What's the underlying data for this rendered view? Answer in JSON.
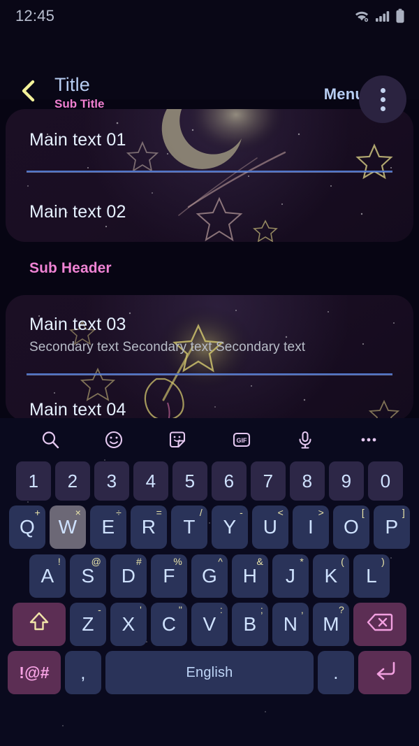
{
  "status_bar": {
    "time": "12:45",
    "icons": [
      "wifi-icon",
      "signal-icon",
      "battery-icon"
    ]
  },
  "app_bar": {
    "back_icon": "chevron-left-icon",
    "title": "Title",
    "subtitle": "Sub Title",
    "menu_label": "Menu",
    "overflow_icon": "more-vertical-icon"
  },
  "content": {
    "card1": {
      "rows": [
        {
          "main": "Main text 01"
        },
        {
          "main": "Main text 02"
        }
      ]
    },
    "sub_header": "Sub Header",
    "card2": {
      "rows": [
        {
          "main": "Main text 03",
          "secondary": "Secondary text Secondary text Secondary text"
        },
        {
          "main": "Main text 04"
        }
      ]
    }
  },
  "keyboard": {
    "toolbar": [
      {
        "name": "search-icon"
      },
      {
        "name": "emoji-icon"
      },
      {
        "name": "sticker-icon"
      },
      {
        "name": "gif-icon",
        "label": "GIF"
      },
      {
        "name": "microphone-icon"
      },
      {
        "name": "more-horizontal-icon"
      }
    ],
    "number_row": [
      "1",
      "2",
      "3",
      "4",
      "5",
      "6",
      "7",
      "8",
      "9",
      "0"
    ],
    "row1": [
      {
        "key": "Q",
        "sup": "+"
      },
      {
        "key": "W",
        "sup": "×",
        "pressed": true
      },
      {
        "key": "E",
        "sup": "÷"
      },
      {
        "key": "R",
        "sup": "="
      },
      {
        "key": "T",
        "sup": "/"
      },
      {
        "key": "Y",
        "sup": "-"
      },
      {
        "key": "U",
        "sup": "<"
      },
      {
        "key": "I",
        "sup": ">"
      },
      {
        "key": "O",
        "sup": "["
      },
      {
        "key": "P",
        "sup": "]"
      }
    ],
    "row2": [
      {
        "key": "A",
        "sup": "!"
      },
      {
        "key": "S",
        "sup": "@"
      },
      {
        "key": "D",
        "sup": "#"
      },
      {
        "key": "F",
        "sup": "%"
      },
      {
        "key": "G",
        "sup": "^"
      },
      {
        "key": "H",
        "sup": "&"
      },
      {
        "key": "J",
        "sup": "*"
      },
      {
        "key": "K",
        "sup": "("
      },
      {
        "key": "L",
        "sup": ")"
      }
    ],
    "row3": {
      "shift_icon": "shift-arrow-icon",
      "keys": [
        {
          "key": "Z",
          "sup": "-"
        },
        {
          "key": "X",
          "sup": "'"
        },
        {
          "key": "C",
          "sup": "\""
        },
        {
          "key": "V",
          "sup": ":"
        },
        {
          "key": "B",
          "sup": ";"
        },
        {
          "key": "N",
          "sup": ","
        },
        {
          "key": "M",
          "sup": "?"
        }
      ],
      "backspace_icon": "backspace-icon"
    },
    "row4": {
      "symbol_label": "!@#",
      "comma": ",",
      "space_label": "English",
      "period": ".",
      "enter_icon": "enter-icon"
    }
  },
  "colors": {
    "page_bg": "#070513",
    "card_bg": "#1b0f24",
    "keyboard_bg": "#0a0a1e",
    "title_blue": "#b7cdf2",
    "subtitle_pink": "#f07fd0",
    "divider_blue": "#4f74c8",
    "key_alpha": "#2a3359",
    "key_num": "#2d2747",
    "key_fn": "#5c2e54",
    "key_pressed": "#6c6876",
    "sup_yellow": "#e9e4a9",
    "accent_pink": "#f7a3e4"
  }
}
